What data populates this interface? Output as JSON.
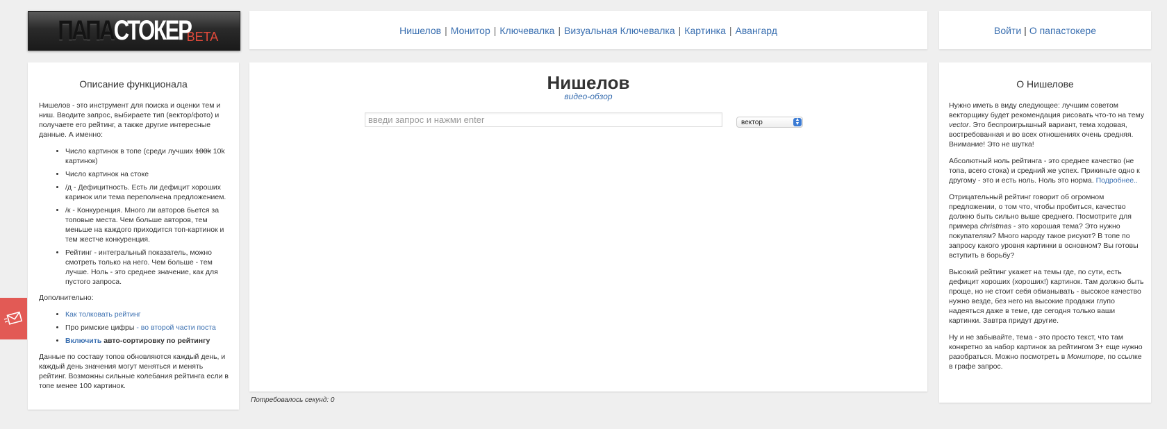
{
  "logo": {
    "part1": "ПАПА",
    "part2": "СТОКЕР",
    "part3": "BETA"
  },
  "nav": [
    {
      "label": "Нишелов"
    },
    {
      "label": "Монитор"
    },
    {
      "label": "Ключевалка"
    },
    {
      "label": "Визуальная Ключевалка"
    },
    {
      "label": "Картинка"
    },
    {
      "label": "Авангард"
    }
  ],
  "separator": "|",
  "auth": {
    "login": "Войти",
    "about": "О папастокере"
  },
  "left": {
    "title": "Описание функционала",
    "intro": "Нишелов - это инструмент для поиска и оценки тем и ниш. Вводите запрос, выбираете тип (вектор/фото) и получаете его рейтинг, а также другие интересные данные. А именно:",
    "items": [
      {
        "a": "Число картинок в топе (среди лучших ",
        "strike": "100k",
        "b": " 10k картинок)"
      },
      {
        "text": "Число картинок на стоке"
      },
      {
        "text": "/д - Дефицитность. Есть ли дефицит хороших каринок или тема переполнена предложением."
      },
      {
        "text": "/к - Конкуренция. Много ли авторов бьется за топовые места. Чем больше авторов, тем меньше на каждого приходится топ-картинок и тем жестче конкуренция."
      },
      {
        "text": "Рейтинг - интегральный показатель, можно смотреть только на него. Чем больше - тем лучше. Ноль - это среднее значение, как для пустого запроса."
      }
    ],
    "extra_title": "Дополнительно:",
    "extra": {
      "rating_link": "Как толковать рейтинг",
      "roman_text": "Про римские цифры",
      "roman_link": " - во второй части поста",
      "enable_link": "Включить",
      "enable_text": " авто-сортировку по рейтингу"
    },
    "footer": "Данные по составу топов обновляются каждый день, и каждый день значения могут меняться и менять рейтинг. Возможны сильные колебания рейтинга если в топе менее 100 картинок."
  },
  "center": {
    "title": "Нишелов",
    "video_link": "видео-обзор",
    "search_placeholder": "введи запрос и нажми enter",
    "type_selected": "вектор",
    "elapsed": "Потребовалось секунд: 0"
  },
  "right": {
    "title": "О Нишелове",
    "p1a": "Нужно иметь в виду следующее: лучшим советом векторщику будет рекомендация рисовать что-то на тему ",
    "p1i": "vector",
    "p1b": ". Это беспроигрышный вариант, тема ходовая, востребованная и во всех отношениях очень средняя. Внимание! Это не шутка!",
    "p2": "Абсолютный ноль рейтинга - это среднее качество (не топа, всего стока) и средний же успех. Прикиньте одно к другому - это и есть ноль. Ноль это норма.",
    "p2link": "Подробнее..",
    "p3a": "Отрицательный рейтинг говорит об огромном предложении, о том что, чтобы пробиться, качество должно быть сильно выше среднего. Посмотрите для примера ",
    "p3i": "christmas",
    "p3b": " - это хорошая тема? Это нужно покупателям? Много народу такое рисуют? В топе по запросу какого уровня картинки в основном? Вы готовы вступить в борьбу?",
    "p4": "Высокий рейтинг укажет на темы где, по сути, есть дефицит хороших (хороших!) картинок. Там должно быть проще, но не стоит себя обманывать - высокое качество нужно везде, без него на высокие продажи глупо надеяться даже в теме, где сегодня только ваши картинки. Завтра придут другие.",
    "p5a": "Ну и не забывайте, тема - это просто текст, что там конкретно за набор картинок за рейтингом 3+ еще нужно разобраться. Можно посмотреть в ",
    "p5i": "Мониторе",
    "p5b": ", по ссылке в графе запрос."
  },
  "icons": {
    "feedback": "envelope-icon",
    "select_arrow": "updown-arrow-icon"
  },
  "colors": {
    "link": "#3a6fb0",
    "feedback_bg": "#e25a55",
    "logo_accent": "#e24a3b"
  }
}
